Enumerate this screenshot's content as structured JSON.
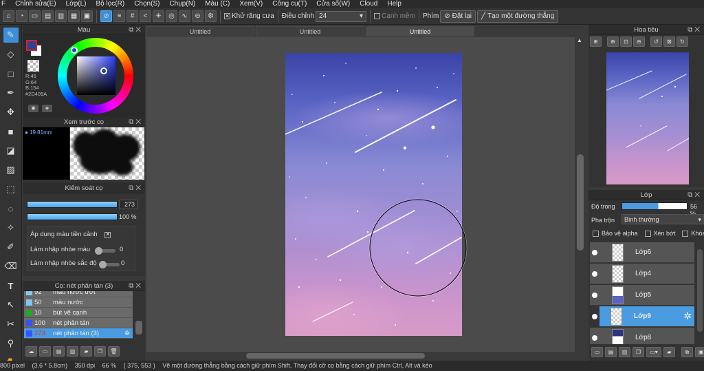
{
  "menu": [
    "F",
    "Chỉnh sửa(E)",
    "Lớp(L)",
    "Bộ lọc(R)",
    "Chọn(S)",
    "Chụp(N)",
    "Màu (C)",
    "Xem(V)",
    "Công cụ(T)",
    "Cửa số(W)",
    "Cloud",
    "Help"
  ],
  "toolbar": {
    "antialias_label": "Khử răng cưa",
    "adjust_label": "Điều chỉnh",
    "adjust_value": "24",
    "smooth_edge_label": "Cạnh mềm",
    "key_label": "Phím",
    "reset_label": "Đặt lại",
    "line_label": "Tạo một đường thẳng"
  },
  "color_panel": {
    "title": "Màu",
    "r": "R:45",
    "g": "G:64",
    "b": "B:154",
    "hex": "#2D409A",
    "fg_color": "#2D409A"
  },
  "preview_panel": {
    "title": "Xem trước cọ",
    "size": "19.81mm"
  },
  "brush_control": {
    "title": "Kiểm soát cọ",
    "size_value": "273",
    "opacity_value": "100 %",
    "apply_fg_label": "Áp dụng màu tiền cảnh",
    "blur_color_label": "Làm nhập nhòe màu",
    "blur_color_value": "0",
    "blur_hue_label": "Làm nhập nhòe sắc độ",
    "blur_hue_value": "0"
  },
  "brush_list": {
    "title": "Cọ: nét phân tán (3)",
    "items": [
      {
        "num": "92",
        "name": "màu nước ướt",
        "color": "#7fc8f0"
      },
      {
        "num": "50",
        "name": "màu nước",
        "color": "#7fc8f0"
      },
      {
        "num": "10",
        "name": "bút vẽ cạnh",
        "color": "#22aa22"
      },
      {
        "num": "100",
        "name": "nét phân tán",
        "color": "#3355ff"
      },
      {
        "num": "273",
        "name": "nét phân tán (3)",
        "color": "#3355ff"
      }
    ]
  },
  "tabs": [
    "Untitled",
    "Untitled",
    "Untitled"
  ],
  "navigator": {
    "title": "Hoa tiêu"
  },
  "layers": {
    "title": "Lớp",
    "opacity_label": "Độ trong",
    "opacity_value": "56 %",
    "opacity_level": 0.56,
    "blend_label": "Pha trộn",
    "blend_value": "Bình thường",
    "protect_alpha_label": "Bảo vệ alpha",
    "clipping_label": "Xén bớt",
    "lock_label": "Khóa",
    "items": [
      "Lớp6",
      "Lớp4",
      "Lớp5",
      "Lớp9",
      "Lớp8"
    ]
  },
  "status": {
    "canvas_size": "800 pixel",
    "physical_size": "(3.6 * 5.8cm)",
    "dpi": "350 dpi",
    "zoom": "66 %",
    "cursor": "( 375, 553 )",
    "hint": "Vẽ một đường thẳng bằng cách giữ phím Shift, Thay đổi cỡ cọ bằng cách giữ phím Ctrl, Alt và kéo"
  }
}
